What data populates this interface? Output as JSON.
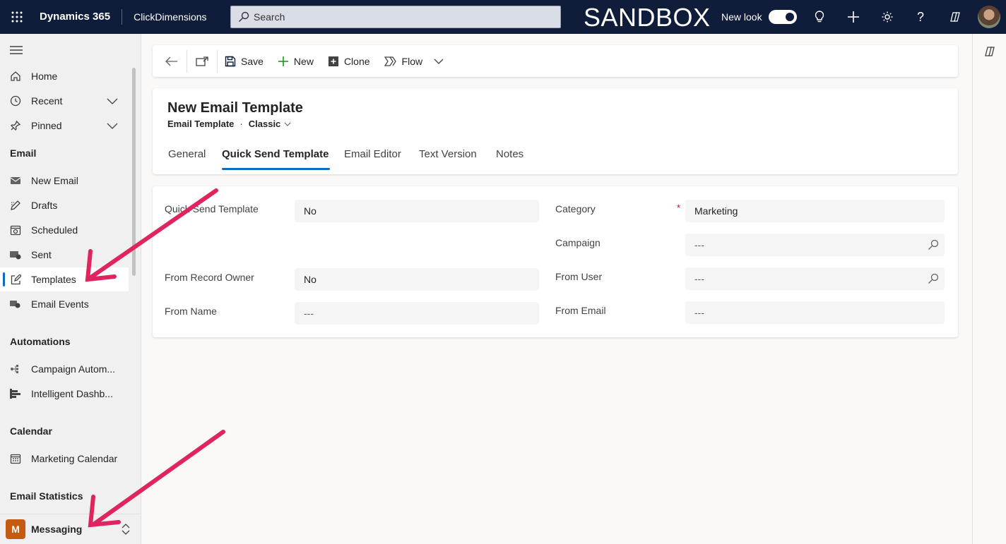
{
  "topbar": {
    "brand": "Dynamics 365",
    "app": "ClickDimensions",
    "search_placeholder": "Search",
    "environment": "SANDBOX",
    "new_look_label": "New look",
    "new_look_on": true
  },
  "sidebar": {
    "items_top": [
      {
        "label": "Home",
        "icon": "home-icon"
      },
      {
        "label": "Recent",
        "icon": "clock-icon",
        "expandable": true
      },
      {
        "label": "Pinned",
        "icon": "pin-icon",
        "expandable": true
      }
    ],
    "groups": [
      {
        "title": "Email",
        "items": [
          {
            "label": "New Email",
            "icon": "mail-icon"
          },
          {
            "label": "Drafts",
            "icon": "drafts-icon"
          },
          {
            "label": "Scheduled",
            "icon": "calendar-clock-icon"
          },
          {
            "label": "Sent",
            "icon": "sent-icon"
          },
          {
            "label": "Templates",
            "icon": "edit-icon",
            "active": true
          },
          {
            "label": "Email Events",
            "icon": "events-icon"
          }
        ]
      },
      {
        "title": "Automations",
        "items": [
          {
            "label": "Campaign Autom...",
            "icon": "flowchart-icon"
          },
          {
            "label": "Intelligent Dashb...",
            "icon": "bars-icon"
          }
        ]
      },
      {
        "title": "Calendar",
        "items": [
          {
            "label": "Marketing Calendar",
            "icon": "calendar-icon"
          }
        ]
      },
      {
        "title": "Email Statistics",
        "items": []
      }
    ],
    "area": {
      "badge": "M",
      "label": "Messaging",
      "badge_color": "#c55a11"
    }
  },
  "commandbar": {
    "save": "Save",
    "new": "New",
    "clone": "Clone",
    "flow": "Flow"
  },
  "record": {
    "title": "New Email Template",
    "entity": "Email Template",
    "form": "Classic",
    "tabs": [
      "General",
      "Quick Send Template",
      "Email Editor",
      "Text Version",
      "Notes"
    ],
    "active_tab": "Quick Send Template"
  },
  "form": {
    "left": [
      {
        "label": "Quick Send Template",
        "value": "No"
      },
      {
        "label": "From Record Owner",
        "value": "No"
      },
      {
        "label": "From Name",
        "value": "---"
      }
    ],
    "right": [
      {
        "label": "Category",
        "value": "Marketing",
        "required": "*"
      },
      {
        "label": "Campaign",
        "value": "---",
        "lookup": true
      },
      {
        "label": "From User",
        "value": "---",
        "lookup": true
      },
      {
        "label": "From Email",
        "value": "---"
      }
    ]
  },
  "colors": {
    "topbar": "#0f1d3b",
    "accent": "#0f6cbd",
    "annotation_arrow": "#e0245e",
    "area_badge": "#c55a11"
  }
}
